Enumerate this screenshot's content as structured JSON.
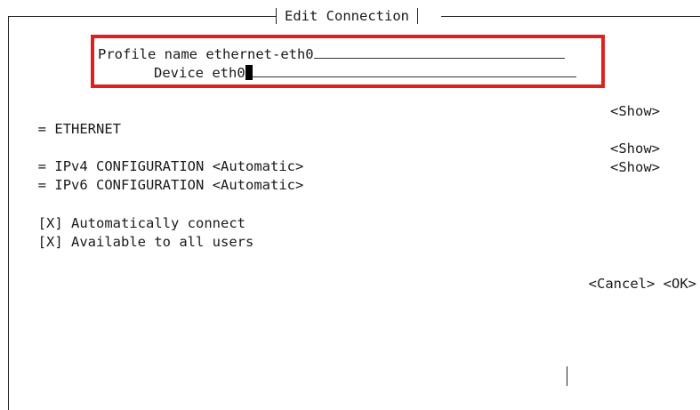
{
  "window": {
    "title": "Edit Connection"
  },
  "profile": {
    "profile_name_label": "Profile name",
    "profile_name_value": "ethernet-eth0",
    "device_label": "Device",
    "device_value": "eth0"
  },
  "sections": [
    {
      "marker": "=",
      "label": "ETHERNET",
      "mode": "",
      "action": "<Show>"
    },
    {
      "marker": "=",
      "label": "IPv4 CONFIGURATION",
      "mode": "<Automatic>",
      "action": "<Show>"
    },
    {
      "marker": "=",
      "label": "IPv6 CONFIGURATION",
      "mode": "<Automatic>",
      "action": "<Show>"
    }
  ],
  "options": [
    {
      "checkbox": "[X]",
      "label": "Automatically connect"
    },
    {
      "checkbox": "[X]",
      "label": "Available to all users"
    }
  ],
  "buttons": {
    "cancel": "<Cancel>",
    "ok": "<OK>"
  },
  "colors": {
    "highlight_border": "#e0201f",
    "text": "#1a1a1a",
    "background": "#ffffff"
  }
}
